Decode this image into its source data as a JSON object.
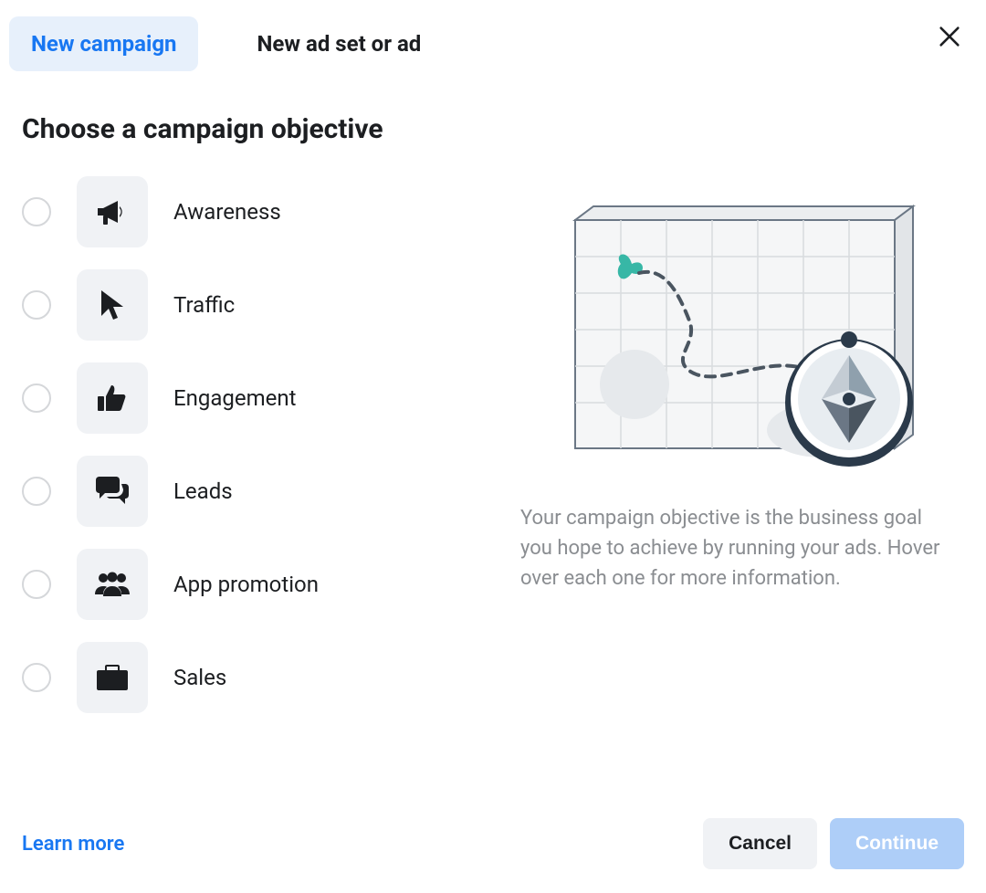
{
  "tabs": {
    "new_campaign": "New campaign",
    "new_ad_set": "New ad set or ad"
  },
  "heading": "Choose a campaign objective",
  "objectives": [
    {
      "key": "awareness",
      "label": "Awareness",
      "icon": "megaphone-icon"
    },
    {
      "key": "traffic",
      "label": "Traffic",
      "icon": "cursor-icon"
    },
    {
      "key": "engagement",
      "label": "Engagement",
      "icon": "like-icon"
    },
    {
      "key": "leads",
      "label": "Leads",
      "icon": "comments-icon"
    },
    {
      "key": "app_promotion",
      "label": "App promotion",
      "icon": "group-icon"
    },
    {
      "key": "sales",
      "label": "Sales",
      "icon": "briefcase-icon"
    }
  ],
  "info_text": "Your campaign objective is the business goal you hope to achieve by running your ads. Hover over each one for more information.",
  "footer": {
    "learn_more": "Learn more",
    "cancel": "Cancel",
    "continue": "Continue"
  },
  "colors": {
    "blue": "#1877f2",
    "light_blue": "#aecef8",
    "tile_bg": "#f0f2f5",
    "gray_text": "#8a8d91"
  }
}
